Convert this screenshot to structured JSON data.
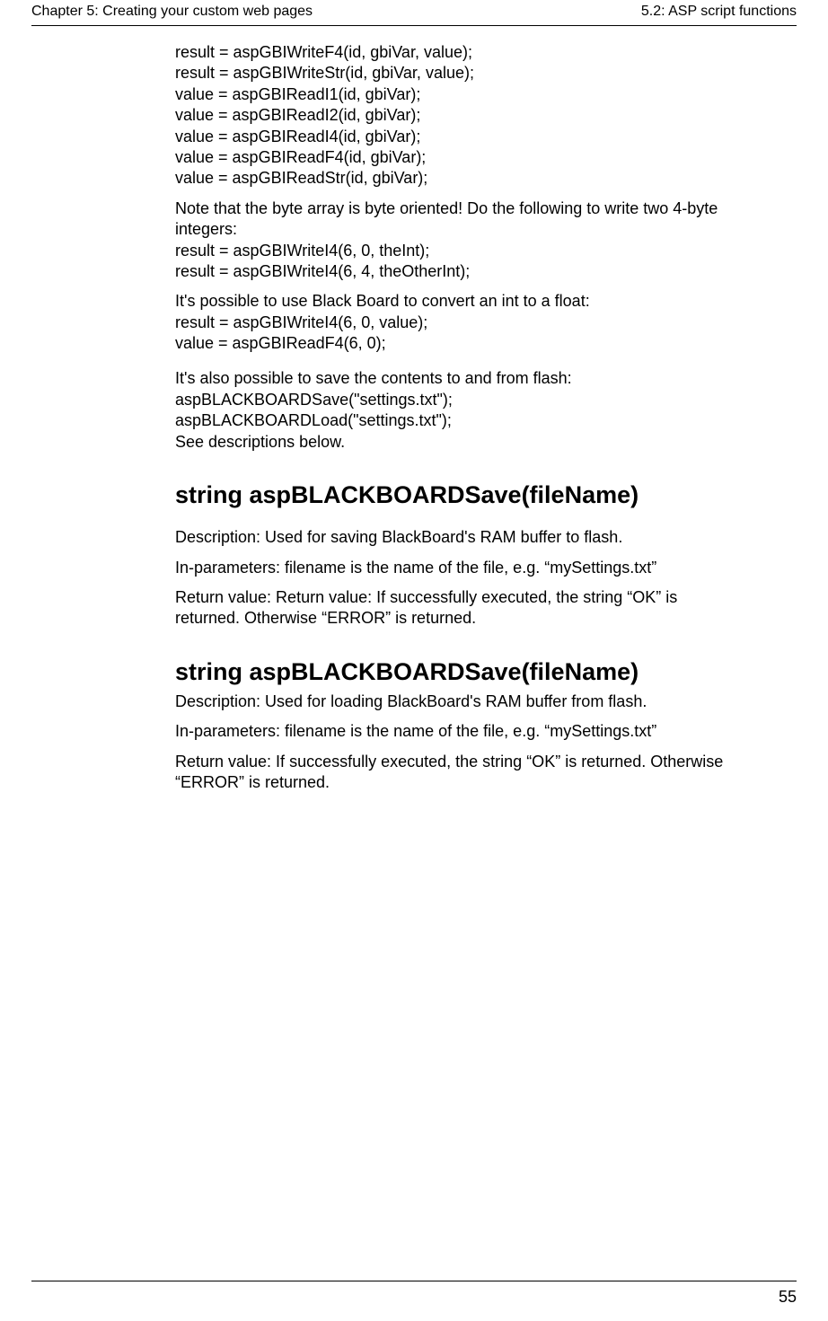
{
  "header": {
    "left": "Chapter 5: Creating your custom web pages",
    "right": "5.2: ASP script functions"
  },
  "body": {
    "codeBlock1": "result = aspGBIWriteF4(id, gbiVar, value);\nresult = aspGBIWriteStr(id, gbiVar, value);\nvalue = aspGBIReadI1(id, gbiVar);\nvalue = aspGBIReadI2(id, gbiVar);\nvalue = aspGBIReadI4(id, gbiVar);\nvalue = aspGBIReadF4(id, gbiVar);\nvalue = aspGBIReadStr(id, gbiVar);",
    "para2": "Note that the byte array is byte oriented! Do the following to write two 4-byte integers:\nresult = aspGBIWriteI4(6, 0, theInt);\nresult = aspGBIWriteI4(6, 4, theOtherInt);",
    "para3": "It's possible to use Black Board to convert an int to a float:\nresult = aspGBIWriteI4(6, 0, value);\nvalue = aspGBIReadF4(6, 0);",
    "para4": "It's also possible to save the contents to and from flash:\naspBLACKBOARDSave(\"settings.txt\");\naspBLACKBOARDLoad(\"settings.txt\");\nSee descriptions below.",
    "h2a": "string aspBLACKBOARDSave(fileName)",
    "desc_a1": "Description: Used for saving BlackBoard's RAM buffer to flash.",
    "desc_a2": "In-parameters: filename is the name of the file, e.g. “mySettings.txt”",
    "desc_a3": "Return value: Return value: If successfully executed, the string “OK” is returned. Otherwise “ERROR” is returned.",
    "h2b": "string aspBLACKBOARDSave(fileName)",
    "desc_b1": "Description: Used for loading BlackBoard's RAM buffer from flash.",
    "desc_b2": "In-parameters: filename is the name of the file, e.g. “mySettings.txt”",
    "desc_b3": "Return value: If successfully executed, the string “OK” is returned. Otherwise “ERROR” is returned."
  },
  "footer": {
    "pageNumber": "55"
  }
}
